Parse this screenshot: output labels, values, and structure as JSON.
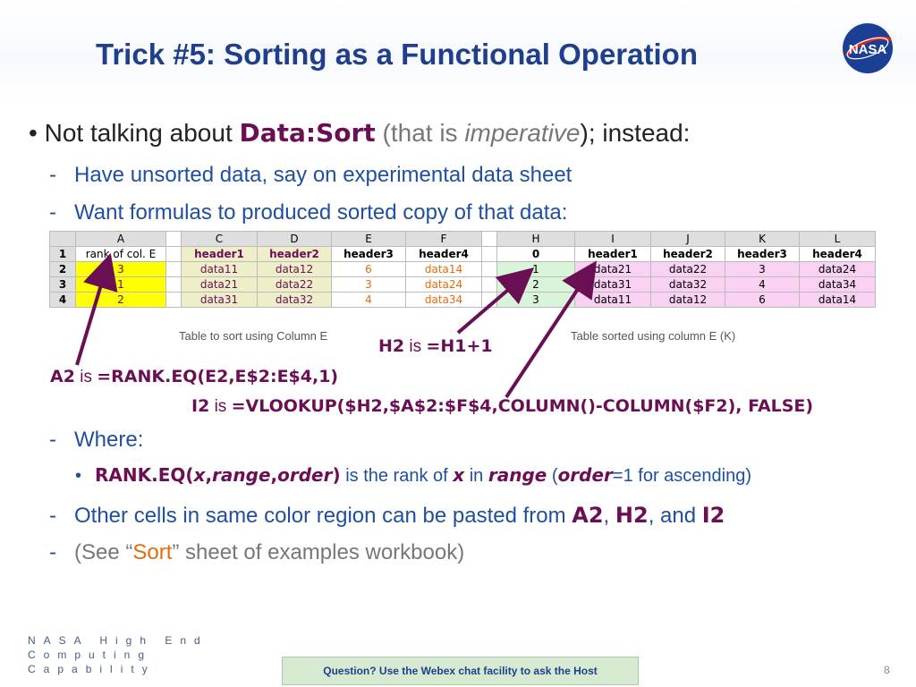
{
  "slide": {
    "title": "Trick #5: Sorting as a Functional Operation",
    "logo_text": "NASA",
    "bullet1": {
      "pre": "Not talking about ",
      "code": "Data:Sort",
      "mid": "  (that is ",
      "em": "imperative",
      "post": "); instead:"
    },
    "sub1": "Have unsorted data, say on experimental data sheet",
    "sub2": "Want formulas to produced sorted copy of that data:",
    "caption_left": "Table to sort using Column E",
    "caption_right": "Table sorted using column E (K)",
    "h2_note": {
      "ref": "H2",
      "is": " is ",
      "formula": "=H1+1"
    },
    "a2_note": {
      "ref": "A2",
      "is": " is ",
      "formula": "=RANK.EQ(E2,E$2:E$4,1)"
    },
    "i2_note": {
      "ref": "I2",
      "is": " is ",
      "formula": "=VLOOKUP($H2,$A$2:$F$4,COLUMN()-COLUMN($F2), FALSE)"
    },
    "where": "Where:",
    "rank_line": {
      "fn_pre": "RANK.EQ(",
      "x": "x",
      "c1": ",",
      "range": "range",
      "c2": ",",
      "order": "order",
      "fn_post": ")",
      "t1": " is the rank of ",
      "x2": "x",
      "t2": " in ",
      "range2": "range",
      "t3": " (",
      "order2": "order",
      "t4": "=1 for ascending)"
    },
    "other": {
      "pre": "Other cells in same color region can be pasted from ",
      "a2": "A2",
      "sep1": ", ",
      "h2": "H2",
      "sep2": ", and ",
      "i2": "I2"
    },
    "see": {
      "pre": "(See “",
      "sort": "Sort",
      "post": "” sheet of examples workbook)"
    },
    "dash": "-",
    "bullet": "•"
  },
  "sheet": {
    "col_headers": [
      "",
      "A",
      "",
      "C",
      "D",
      "E",
      "F",
      "",
      "H",
      "I",
      "J",
      "K",
      "L"
    ],
    "rows": [
      [
        "1",
        "rank of col. E",
        "",
        "header1",
        "header2",
        "header3",
        "header4",
        "",
        "0",
        "header1",
        "header2",
        "header3",
        "header4"
      ],
      [
        "2",
        "3",
        "",
        "data11",
        "data12",
        "6",
        "data14",
        "",
        "1",
        "data21",
        "data22",
        "3",
        "data24"
      ],
      [
        "3",
        "1",
        "",
        "data21",
        "data22",
        "3",
        "data24",
        "",
        "2",
        "data31",
        "data32",
        "4",
        "data34"
      ],
      [
        "4",
        "2",
        "",
        "data31",
        "data32",
        "4",
        "data34",
        "",
        "3",
        "data11",
        "data12",
        "6",
        "data14"
      ]
    ]
  },
  "footer": {
    "org_line1": "NASA High End",
    "org_line2": "Computing",
    "org_line3": "Capability",
    "question": "Question? Use the Webex chat facility to ask the Host",
    "page": "8"
  },
  "colors": {
    "title": "#1f3f8a",
    "purple": "#6b0f55",
    "blue": "#1f4fa0",
    "yellow": "#ffff00",
    "pink": "#f9d1f2",
    "green": "#d9f5d9"
  }
}
